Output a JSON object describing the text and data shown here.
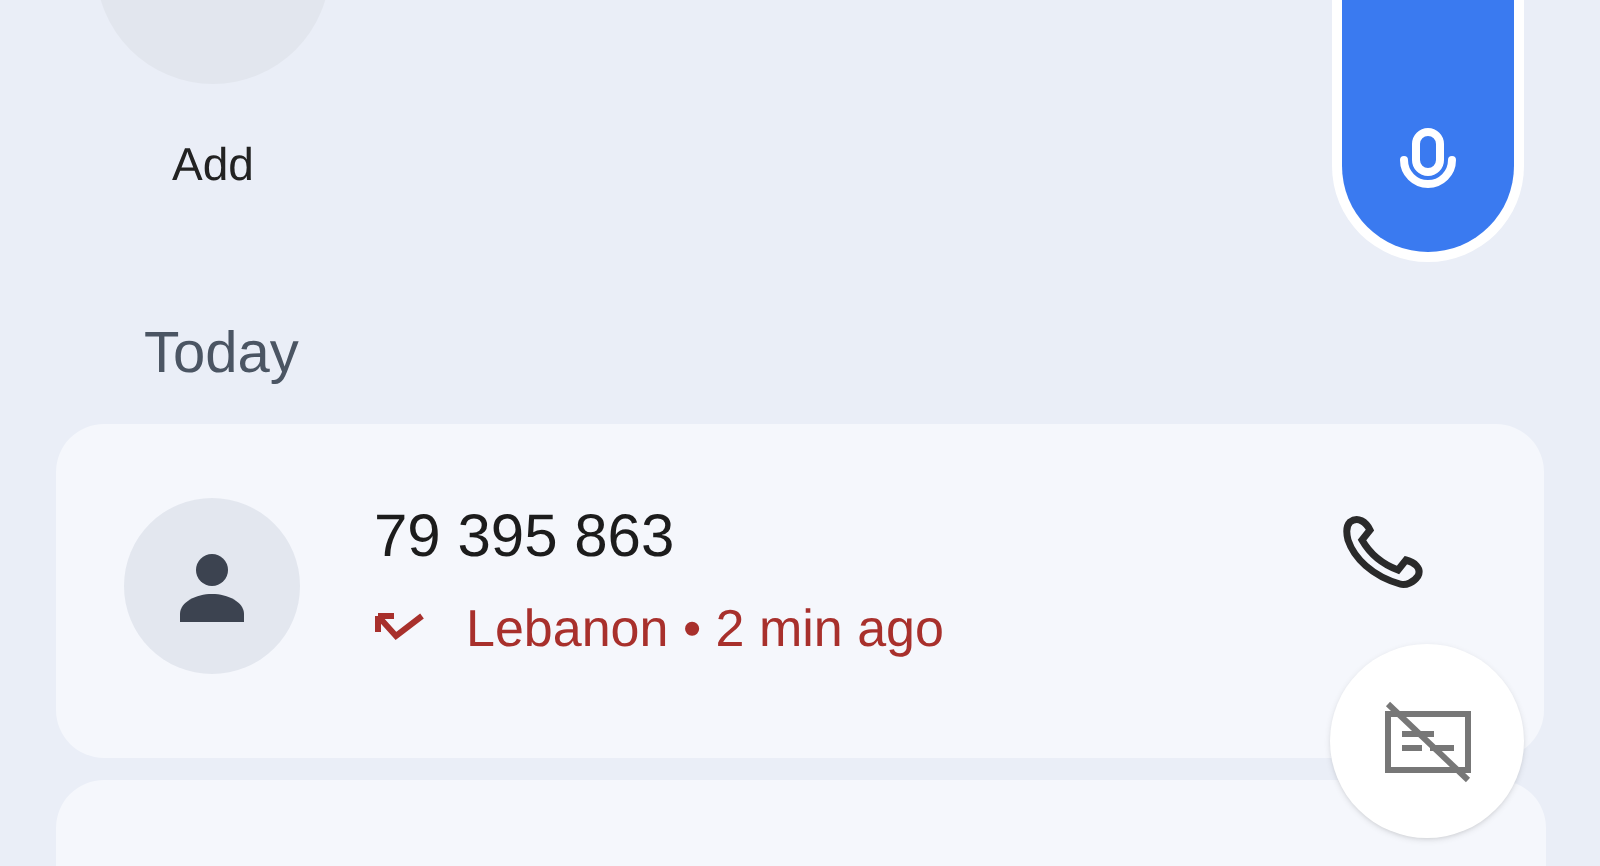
{
  "favorites": [
    {
      "label": "Add"
    }
  ],
  "section_header": "Today",
  "calls": [
    {
      "number": "79 395 863",
      "detail": "Lebanon • 2 min ago",
      "kind": "missed"
    }
  ]
}
